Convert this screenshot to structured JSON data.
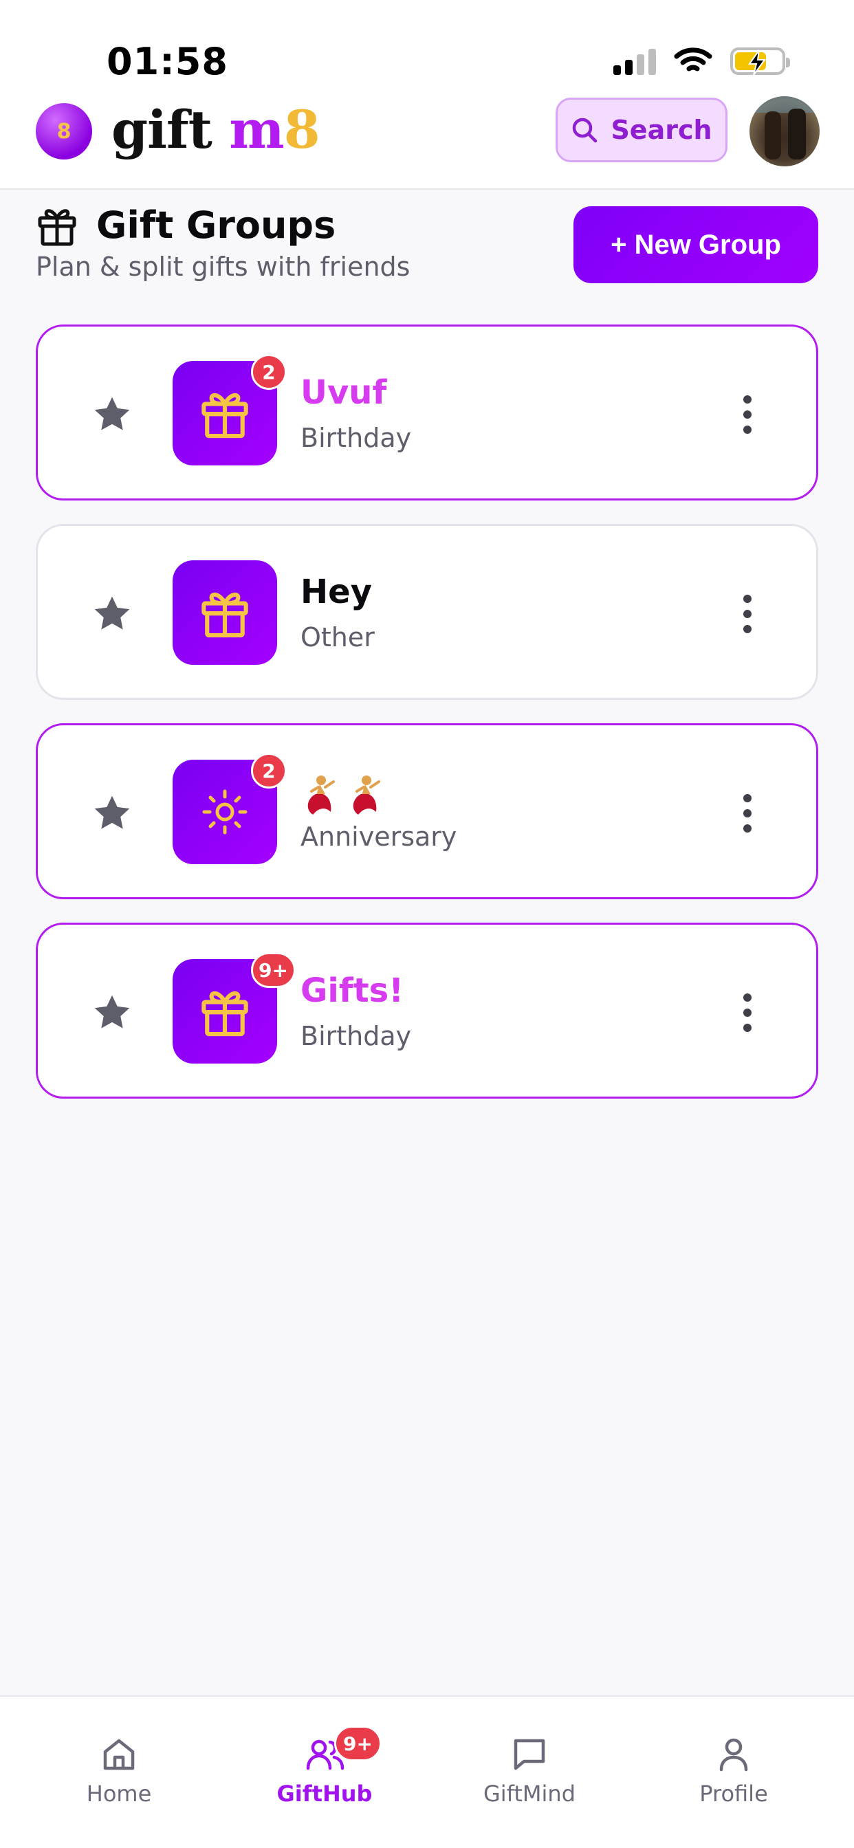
{
  "status_bar": {
    "time": "01:58"
  },
  "header": {
    "logo_badge": "8",
    "logo_word": "gift",
    "logo_m": "m",
    "logo_eight": "8",
    "search_label": "Search"
  },
  "section": {
    "title": "Gift Groups",
    "subtitle": "Plan & split gifts with friends",
    "new_group_label": "+ New Group"
  },
  "groups": [
    {
      "name": "Uvuf",
      "type": "Birthday",
      "badge": "2",
      "icon": "gift-icon",
      "highlighted": true
    },
    {
      "name": "Hey",
      "type": "Other",
      "badge": "",
      "icon": "gift-icon",
      "highlighted": false
    },
    {
      "name": "💃💃",
      "type": "Anniversary",
      "badge": "2",
      "icon": "sun-icon",
      "highlighted": true
    },
    {
      "name": "Gifts!",
      "type": "Birthday",
      "badge": "9+",
      "icon": "gift-icon",
      "highlighted": true
    }
  ],
  "bottom_nav": {
    "items": [
      {
        "label": "Home",
        "icon": "home-icon"
      },
      {
        "label": "GiftHub",
        "icon": "users-icon",
        "badge": "9+",
        "active": true
      },
      {
        "label": "GiftMind",
        "icon": "chat-icon"
      },
      {
        "label": "Profile",
        "icon": "user-icon"
      }
    ]
  },
  "colors": {
    "accent": "#a100ff",
    "highlight_text": "#d63bf0",
    "badge_red": "#ea3b4a",
    "icon_gold": "#f6c445"
  }
}
